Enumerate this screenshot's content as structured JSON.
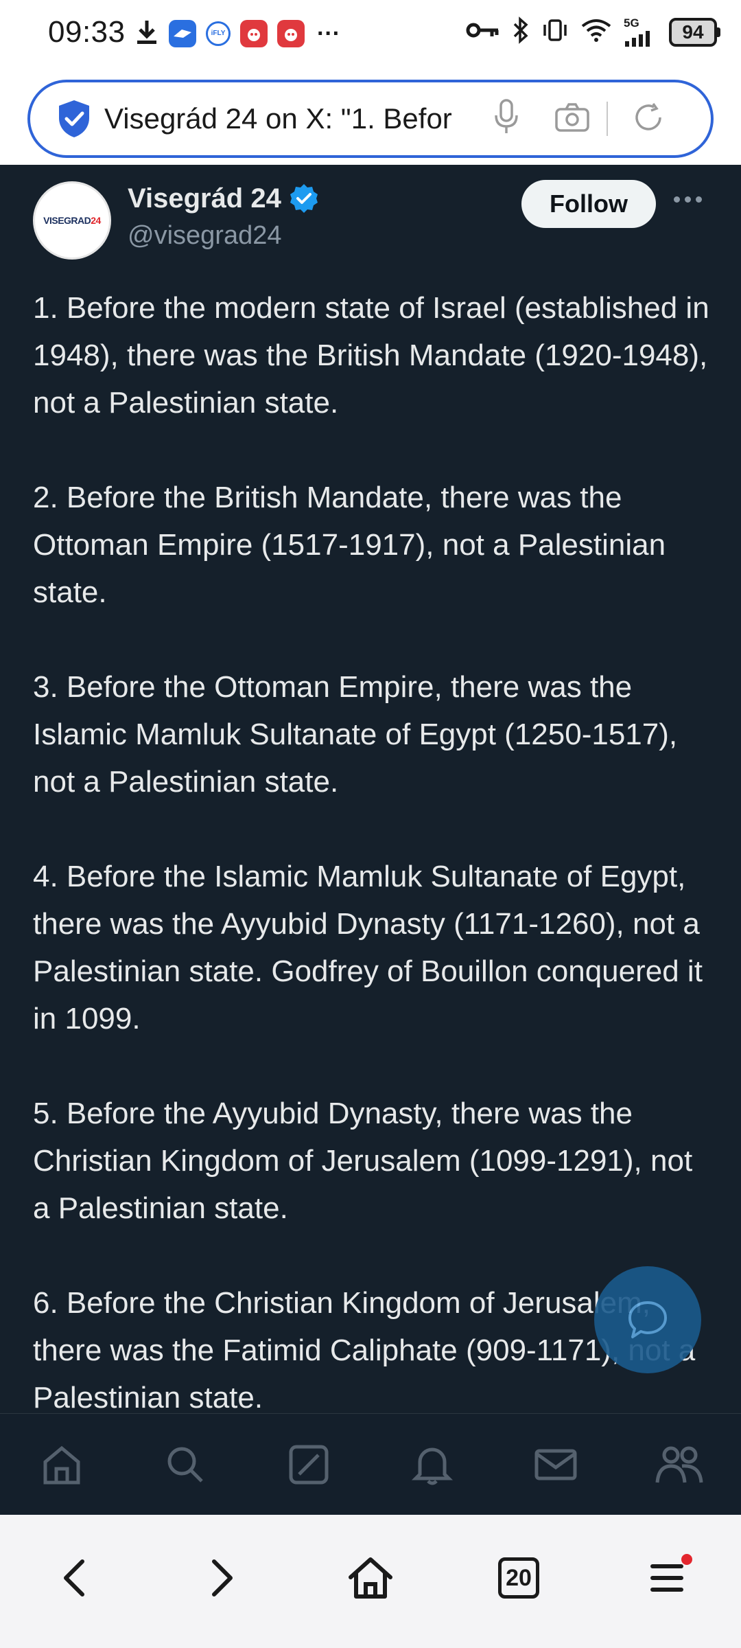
{
  "status_bar": {
    "time": "09:33",
    "overflow": "···",
    "battery": "94",
    "network": "5G"
  },
  "address_bar": {
    "url_text": "Visegrád 24 on X: \"1. Befor"
  },
  "profile": {
    "avatar_text_main": "VISEGRAD",
    "avatar_text_accent": "24",
    "display_name": "Visegrád 24",
    "handle": "@visegrad24",
    "follow_label": "Follow"
  },
  "tweet": {
    "paragraphs": [
      "1. Before the modern state of Israel (established in 1948), there was the British Mandate (1920-1948), not a Palestinian state.",
      "2. Before the British Mandate, there was the Ottoman Empire (1517-1917), not a Palestinian state.",
      "3. Before the Ottoman Empire, there was the Islamic Mamluk Sultanate of Egypt (1250-1517), not a Palestinian state.",
      "4. Before the Islamic Mamluk Sultanate of Egypt, there was the Ayyubid Dynasty (1171-1260), not a Palestinian state. Godfrey of Bouillon conquered it in 1099.",
      "5. Before the Ayyubid Dynasty, there was the Christian Kingdom of Jerusalem (1099-1291), not a Palestinian state.",
      "6. Before the Christian Kingdom of Jerusalem, there was the Fatimid Caliphate (909-1171), not a Palestinian state."
    ]
  },
  "browser_bar": {
    "tab_count": "20"
  },
  "colors": {
    "background": "#15202b",
    "text": "#e7e9ea",
    "muted": "#8b98a5",
    "verified": "#1d9bf0",
    "url_border": "#2f64d8"
  }
}
